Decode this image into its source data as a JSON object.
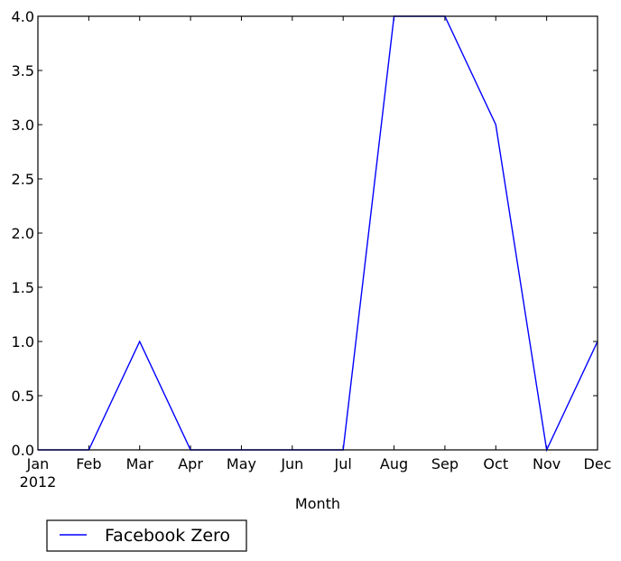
{
  "chart_data": {
    "type": "line",
    "title": "",
    "xlabel": "Month",
    "ylabel": "",
    "categories": [
      "Jan",
      "Feb",
      "Mar",
      "Apr",
      "May",
      "Jun",
      "Jul",
      "Aug",
      "Sep",
      "Oct",
      "Nov",
      "Dec"
    ],
    "x_sublabel": "2012",
    "series": [
      {
        "name": "Facebook Zero",
        "color": "#0000ff",
        "values": [
          0,
          0,
          1,
          0,
          0,
          0,
          0,
          4,
          4,
          3,
          0,
          1
        ]
      }
    ],
    "ylim": [
      0.0,
      4.0
    ],
    "yticks": [
      0.0,
      0.5,
      1.0,
      1.5,
      2.0,
      2.5,
      3.0,
      3.5,
      4.0
    ],
    "ytick_labels": [
      "0.0",
      "0.5",
      "1.0",
      "1.5",
      "2.0",
      "2.5",
      "3.0",
      "3.5",
      "4.0"
    ],
    "grid": false,
    "legend": {
      "placement": "bottom-left, below axes",
      "entries": [
        "Facebook Zero"
      ]
    }
  }
}
